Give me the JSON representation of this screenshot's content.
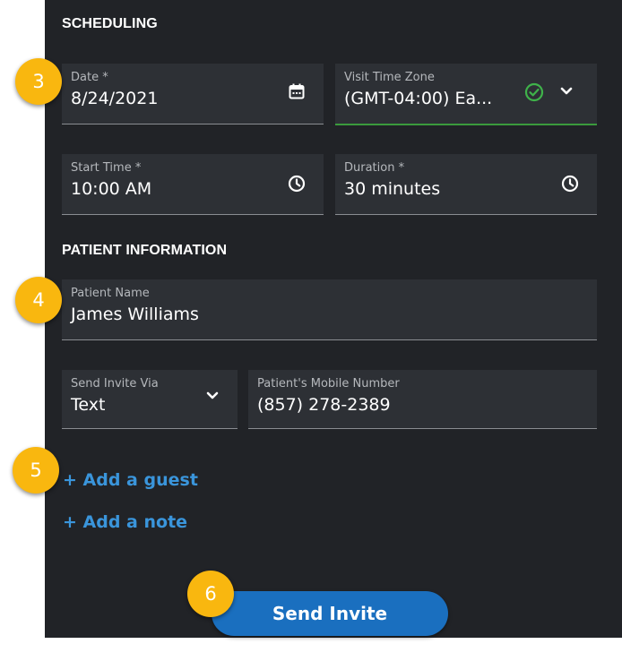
{
  "colors": {
    "panel_bg": "#212327",
    "field_bg": "#2d3035",
    "link": "#3a95db",
    "button_bg": "#1a6fbf",
    "valid": "#3a9a3c",
    "badge": "#f9b70f"
  },
  "scheduling": {
    "heading": "SCHEDULING",
    "date": {
      "label": "Date *",
      "value": "8/24/2021",
      "icon": "calendar-icon"
    },
    "time_zone": {
      "label": "Visit Time Zone",
      "value": "(GMT-04:00) Ea...",
      "status_icon": "check-circle-icon",
      "dropdown_icon": "chevron-down-icon"
    },
    "start_time": {
      "label": "Start Time *",
      "value": "10:00 AM",
      "icon": "clock-icon"
    },
    "duration": {
      "label": "Duration *",
      "value": "30 minutes",
      "icon": "clock-icon"
    }
  },
  "patient": {
    "heading": "PATIENT INFORMATION",
    "name": {
      "label": "Patient Name",
      "value": "James Williams"
    },
    "invite_via": {
      "label": "Send Invite Via",
      "value": "Text",
      "icon": "chevron-down-icon"
    },
    "mobile": {
      "label": "Patient's Mobile Number",
      "value": "(857) 278-2389"
    }
  },
  "links": {
    "add_guest": "+ Add a guest",
    "add_note": "+ Add a note"
  },
  "send_button": "Send Invite",
  "step_badges": [
    "3",
    "4",
    "5",
    "6"
  ]
}
